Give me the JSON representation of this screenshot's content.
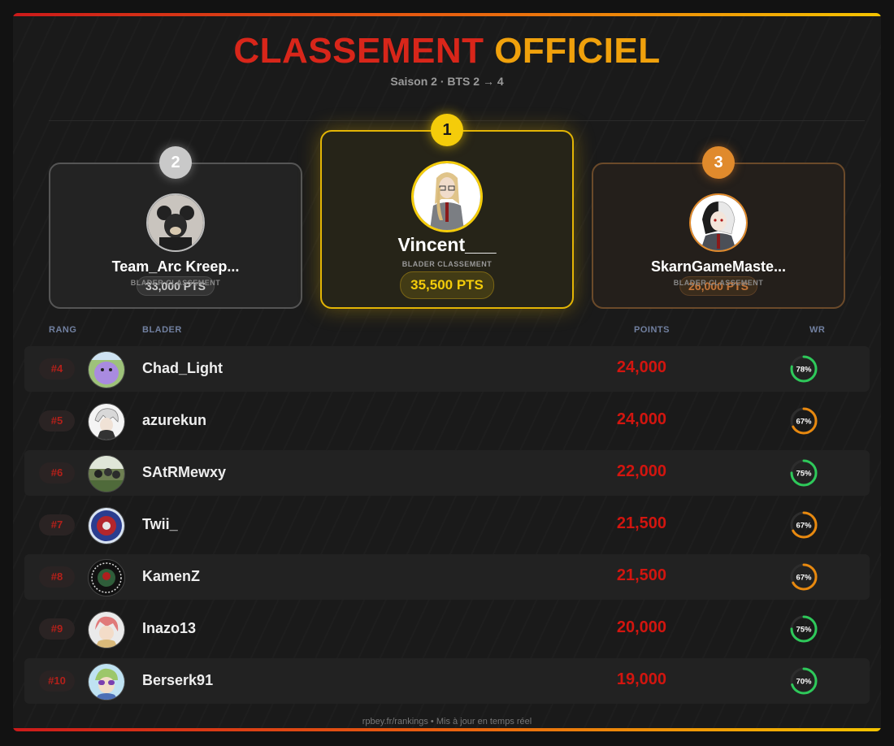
{
  "header": {
    "title_part1": "CLASSEMENT",
    "title_part2": "OFFICIEL",
    "subtitle": "Saison 2 · BTS 2 → 4"
  },
  "podium": [
    {
      "rank": "2",
      "name": "Team_Arc Kreep...",
      "role": "BLADER CLASSEMENT",
      "points": "33,000 PTS",
      "avatar": "mouse-mask-avatar"
    },
    {
      "rank": "1",
      "name": "Vincent___",
      "role": "BLADER CLASSEMENT",
      "points": "35,500 PTS",
      "avatar": "blonde-character-avatar"
    },
    {
      "rank": "3",
      "name": "SkarnGameMaste...",
      "role": "BLADER CLASSEMENT",
      "points": "26,000 PTS",
      "avatar": "split-hair-character-avatar"
    }
  ],
  "table": {
    "headers": {
      "rank": "RANG",
      "blader": "BLADER",
      "points": "POINTS",
      "wr": "WR"
    },
    "rows": [
      {
        "rank": "#4",
        "name": "Chad_Light",
        "points": "24,000",
        "wr_label": "78%",
        "wr_value": 0.78,
        "wr_color": "#2ec95a"
      },
      {
        "rank": "#5",
        "name": "azurekun",
        "points": "24,000",
        "wr_label": "67%",
        "wr_value": 0.67,
        "wr_color": "#e8890f"
      },
      {
        "rank": "#6",
        "name": "SAtRMewxy",
        "points": "22,000",
        "wr_label": "75%",
        "wr_value": 0.75,
        "wr_color": "#2ec95a"
      },
      {
        "rank": "#7",
        "name": "Twii_",
        "points": "21,500",
        "wr_label": "67%",
        "wr_value": 0.67,
        "wr_color": "#e8890f"
      },
      {
        "rank": "#8",
        "name": "KamenZ",
        "points": "21,500",
        "wr_label": "67%",
        "wr_value": 0.67,
        "wr_color": "#e8890f"
      },
      {
        "rank": "#9",
        "name": "Inazo13",
        "points": "20,000",
        "wr_label": "75%",
        "wr_value": 0.75,
        "wr_color": "#2ec95a"
      },
      {
        "rank": "#10",
        "name": "Berserk91",
        "points": "19,000",
        "wr_label": "70%",
        "wr_value": 0.7,
        "wr_color": "#2ec95a"
      }
    ]
  },
  "footer": "rpbey.fr/rankings • Mis à jour en temps réel",
  "colors": {
    "accent_red": "#d2150f",
    "gold": "#f4cc0a",
    "silver": "#c9c9c9",
    "bronze": "#e08a2c"
  }
}
